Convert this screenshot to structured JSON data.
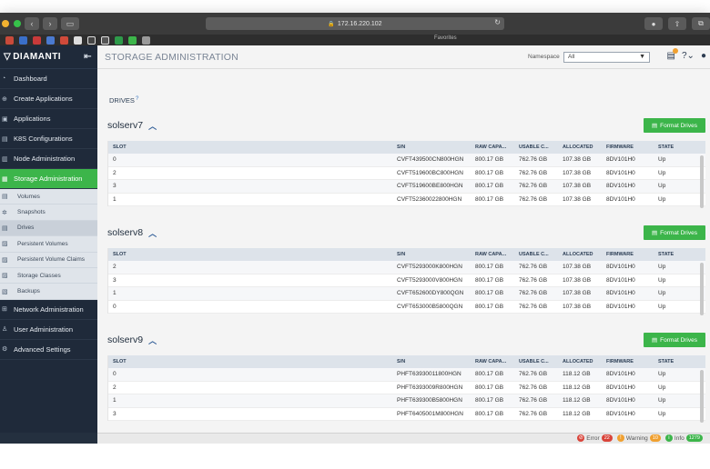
{
  "browser": {
    "url": "172.16.220.102",
    "favorites_label": "Favorites"
  },
  "sidebar": {
    "brand": "DIAMANTI",
    "items": [
      {
        "label": "Dashboard",
        "icon": "dashboard-icon"
      },
      {
        "label": "Create Applications",
        "icon": "create-icon"
      },
      {
        "label": "Applications",
        "icon": "applications-icon"
      },
      {
        "label": "K8S Configurations",
        "icon": "k8s-icon"
      },
      {
        "label": "Node Administration",
        "icon": "node-icon"
      },
      {
        "label": "Storage Administration",
        "icon": "storage-icon"
      }
    ],
    "sub_items": [
      {
        "label": "Volumes",
        "icon": "volumes-icon"
      },
      {
        "label": "Snapshots",
        "icon": "snapshots-icon"
      },
      {
        "label": "Drives",
        "icon": "drives-icon"
      },
      {
        "label": "Persistent Volumes",
        "icon": "pv-icon"
      },
      {
        "label": "Persistent Volume Claims",
        "icon": "pvc-icon"
      },
      {
        "label": "Storage Classes",
        "icon": "storage-classes-icon"
      },
      {
        "label": "Backups",
        "icon": "backups-icon"
      }
    ],
    "items_after": [
      {
        "label": "Network Administration",
        "icon": "network-icon"
      },
      {
        "label": "User Administration",
        "icon": "users-icon"
      },
      {
        "label": "Advanced Settings",
        "icon": "settings-icon"
      }
    ]
  },
  "header": {
    "title": "STORAGE ADMINISTRATION",
    "namespace_label": "Namespace",
    "namespace_value": "All"
  },
  "tab": {
    "label": "DRIVES",
    "help": "?"
  },
  "table_headers": {
    "slot": "SLOT",
    "sn": "S/N",
    "raw": "RAW CAPA...",
    "usable": "USABLE C...",
    "allocated": "ALLOCATED",
    "firmware": "FIRMWARE",
    "state": "STATE"
  },
  "format_button_label": "Format Drives",
  "nodes": [
    {
      "name": "solserv7",
      "rows": [
        {
          "slot": "0",
          "sn": "CVFT439500CN800HGN",
          "raw": "800.17 GB",
          "usable": "762.76 GB",
          "allocated": "107.38 GB",
          "firmware": "8DV101H0",
          "state": "Up"
        },
        {
          "slot": "2",
          "sn": "CVFT519600BC800HGN",
          "raw": "800.17 GB",
          "usable": "762.76 GB",
          "allocated": "107.38 GB",
          "firmware": "8DV101H0",
          "state": "Up"
        },
        {
          "slot": "3",
          "sn": "CVFT519600BE800HGN",
          "raw": "800.17 GB",
          "usable": "762.76 GB",
          "allocated": "107.38 GB",
          "firmware": "8DV101H0",
          "state": "Up"
        },
        {
          "slot": "1",
          "sn": "CVFT52360022800HGN",
          "raw": "800.17 GB",
          "usable": "762.76 GB",
          "allocated": "107.38 GB",
          "firmware": "8DV101H0",
          "state": "Up"
        }
      ]
    },
    {
      "name": "solserv8",
      "rows": [
        {
          "slot": "2",
          "sn": "CVFT5293000K800HGN",
          "raw": "800.17 GB",
          "usable": "762.76 GB",
          "allocated": "107.38 GB",
          "firmware": "8DV101H0",
          "state": "Up"
        },
        {
          "slot": "3",
          "sn": "CVFT5293000V800HGN",
          "raw": "800.17 GB",
          "usable": "762.76 GB",
          "allocated": "107.38 GB",
          "firmware": "8DV101H0",
          "state": "Up"
        },
        {
          "slot": "1",
          "sn": "CVFT652600DY800QGN",
          "raw": "800.17 GB",
          "usable": "762.76 GB",
          "allocated": "107.38 GB",
          "firmware": "8DV101H0",
          "state": "Up"
        },
        {
          "slot": "0",
          "sn": "CVFT653000B5800QGN",
          "raw": "800.17 GB",
          "usable": "762.76 GB",
          "allocated": "107.38 GB",
          "firmware": "8DV101H0",
          "state": "Up"
        }
      ]
    },
    {
      "name": "solserv9",
      "rows": [
        {
          "slot": "0",
          "sn": "PHFT63930011800HGN",
          "raw": "800.17 GB",
          "usable": "762.76 GB",
          "allocated": "118.12 GB",
          "firmware": "8DV101H0",
          "state": "Up"
        },
        {
          "slot": "2",
          "sn": "PHFT6393009R800HGN",
          "raw": "800.17 GB",
          "usable": "762.76 GB",
          "allocated": "118.12 GB",
          "firmware": "8DV101H0",
          "state": "Up"
        },
        {
          "slot": "1",
          "sn": "PHFT639300B5800HGN",
          "raw": "800.17 GB",
          "usable": "762.76 GB",
          "allocated": "118.12 GB",
          "firmware": "8DV101H0",
          "state": "Up"
        },
        {
          "slot": "3",
          "sn": "PHFT6405001M800HGN",
          "raw": "800.17 GB",
          "usable": "762.76 GB",
          "allocated": "118.12 GB",
          "firmware": "8DV101H0",
          "state": "Up"
        }
      ]
    }
  ],
  "statusbar": {
    "error_label": "Error",
    "error_count": "22",
    "warning_label": "Warning",
    "warning_count": "10",
    "info_label": "Info",
    "info_count": "1279",
    "colors": {
      "error": "#d9443a",
      "warning": "#f0a030",
      "info": "#3cb54a"
    }
  },
  "colors": {
    "accent_green": "#3cb54a",
    "sidebar_bg": "#1f2a3a"
  }
}
